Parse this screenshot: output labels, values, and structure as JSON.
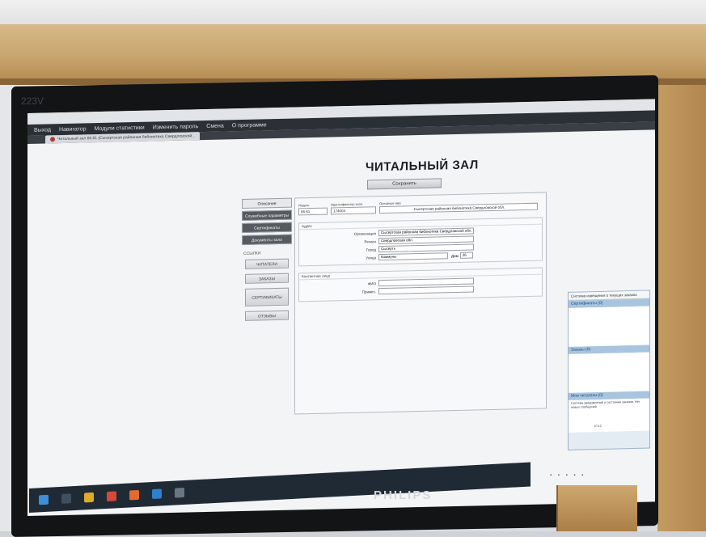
{
  "bezel_label": "223V",
  "brand": "PHILIPS",
  "menu": {
    "items": [
      "Выход",
      "Навигатор",
      "Модули статистики",
      "Изменить пароль",
      "Смена",
      "О программе"
    ]
  },
  "window_tab": {
    "label": "Читальный зал 66.61 (Сысертская районная библиотека Свердловской..."
  },
  "page": {
    "title": "ЧИТАЛЬНЫЙ ЗАЛ",
    "save_label": "Сохранить"
  },
  "leftnav": {
    "tabs": [
      "Описание",
      "Служебные параметры",
      "Сертификаты",
      "Документы зала"
    ],
    "links_caption": "ССЫЛКИ",
    "links": [
      "ЧИТАТЕЛИ",
      "ЗАКАЗЫ",
      "СЕРТИФИКАТЫ",
      "ОТЗЫВЫ"
    ]
  },
  "form": {
    "index_label": "Индекс",
    "index_value": "66.61",
    "id_label": "Идентификатор зала",
    "id_value": "174003",
    "name_label": "Основное имя",
    "name_value": "Сысертская районная библиотека Свердловской обл.",
    "address_title": "Адрес",
    "org_label": "Организация",
    "org_value": "Сысертская районная библиотека Свердловской обл.",
    "region_label": "Регион",
    "region_value": "Свердловская обл.",
    "city_label": "Город",
    "city_value": "Сысерть",
    "street_label": "Улица",
    "street_value": "Коммуны",
    "house_label": "Дом",
    "house_value": "26",
    "contact_title": "Контактное лицо",
    "fio_label": "ФИО",
    "fio_value": "",
    "note_label": "Примеч.",
    "note_value": ""
  },
  "right_panel": {
    "header": "Система извещения о текущих заказах",
    "sections": [
      "Сертификаты (0)",
      "Заказы (0)",
      "Мои читатели (0)"
    ],
    "note": "Система уведомлений о состоянии заказов. Нет новых сообщений."
  },
  "tray": {
    "time": "10:12"
  }
}
